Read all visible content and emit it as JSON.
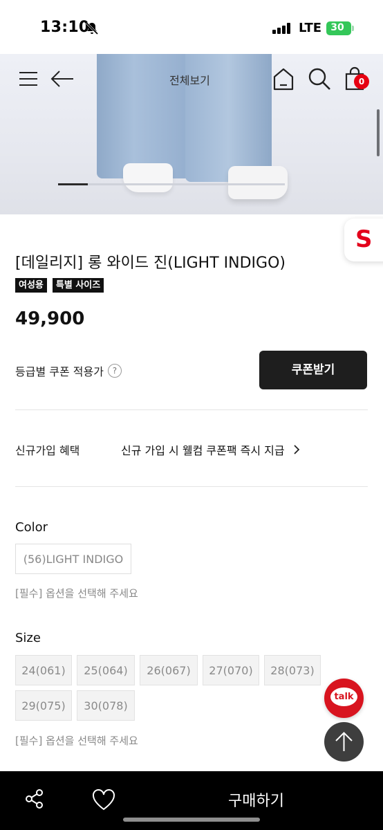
{
  "status_bar": {
    "time": "13:10",
    "network": "LTE",
    "battery": "30"
  },
  "header": {
    "title": "전체보기",
    "cart_count": "0",
    "image_progress": 0.13
  },
  "brand_badge": "S",
  "product": {
    "title": "[데일리지] 롱 와이드 진(LIGHT INDIGO)",
    "tags": [
      "여성용",
      "특별 사이즈"
    ],
    "price": "49,900"
  },
  "coupon": {
    "label": "등급별 쿠폰 적용가",
    "help": "?",
    "button": "쿠폰받기"
  },
  "benefit": {
    "label": "신규가입 혜택",
    "text": "신규 가입 시 웰컴 쿠폰팩 즉시 지급"
  },
  "color": {
    "label": "Color",
    "options": [
      "(56)LIGHT INDIGO"
    ],
    "note": "[필수] 옵션을 선택해 주세요"
  },
  "size": {
    "label": "Size",
    "options": [
      "24(061)",
      "25(064)",
      "26(067)",
      "27(070)",
      "28(073)",
      "29(075)",
      "30(078)"
    ],
    "note": "[필수] 옵션을 선택해 주세요"
  },
  "floating": {
    "talk": "talk"
  },
  "bottom_bar": {
    "buy": "구매하기"
  },
  "colors": {
    "accent_red": "#e60012",
    "dark_button": "#1e1e1e"
  }
}
